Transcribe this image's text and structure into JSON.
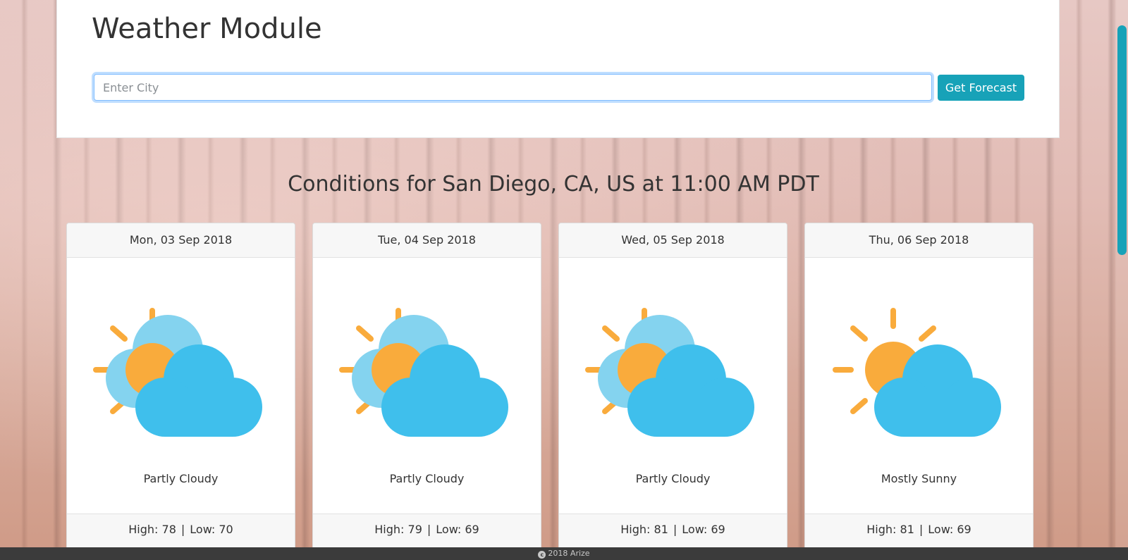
{
  "header": {
    "title": "Weather Module",
    "search_placeholder": "Enter City",
    "search_value": "",
    "button_label": "Get Forecast"
  },
  "conditions_title": "Conditions for San Diego, CA, US at 11:00 AM PDT",
  "forecast": [
    {
      "date": "Mon, 03 Sep 2018",
      "condition": "Partly Cloudy",
      "icon": "partly-cloudy-icon",
      "high": "High: 78",
      "low": "Low: 70"
    },
    {
      "date": "Tue, 04 Sep 2018",
      "condition": "Partly Cloudy",
      "icon": "partly-cloudy-icon",
      "high": "High: 79",
      "low": "Low: 69"
    },
    {
      "date": "Wed, 05 Sep 2018",
      "condition": "Partly Cloudy",
      "icon": "partly-cloudy-icon",
      "high": "High: 81",
      "low": "Low: 69"
    },
    {
      "date": "Thu, 06 Sep 2018",
      "condition": "Mostly Sunny",
      "icon": "mostly-sunny-icon",
      "high": "High: 81",
      "low": "Low: 69"
    }
  ],
  "footer": {
    "copyright": "2018 Arize"
  },
  "colors": {
    "accent": "#17a2b8",
    "sun": "#f9ab3c",
    "cloud_front": "#3fbfec",
    "cloud_back": "#84d3ef"
  }
}
